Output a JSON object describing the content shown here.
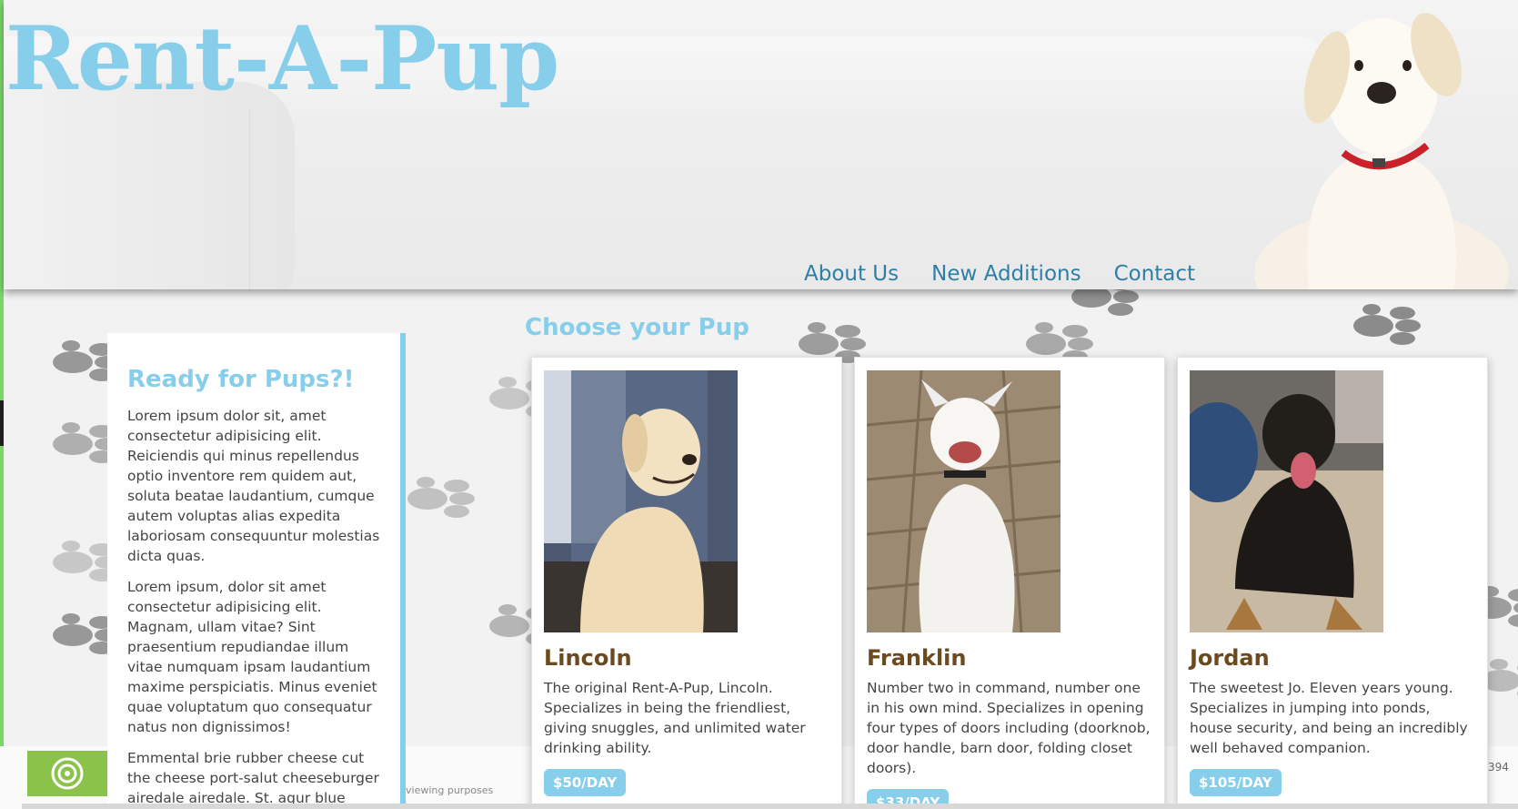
{
  "site": {
    "logo": "Rent-A-Pup",
    "nav": [
      "About Us",
      "New Additions",
      "Contact"
    ]
  },
  "sidebar": {
    "title": "Ready for Pups?!",
    "paragraphs": [
      "Lorem ipsum dolor sit, amet consectetur adipisicing elit. Reiciendis qui minus repellendus optio inventore rem quidem aut, soluta beatae laudantium, cumque autem voluptas alias expedita laboriosam consequuntur molestias dicta quas.",
      "Lorem ipsum, dolor sit amet consectetur adipisicing elit. Magnam, ullam vitae? Sint praesentium repudiandae illum vitae numquam ipsam laudantium maxime perspiciatis. Minus eveniet quae voluptatum quo consequatur natus non dignissimos!",
      "Emmental brie rubber cheese cut the cheese port-salut cheeseburger airedale airedale. St. agur blue cheese babybel manchego caerphilly."
    ]
  },
  "main": {
    "section_title": "Choose your Pup",
    "cards": [
      {
        "name": "Lincoln",
        "description": "The original Rent-A-Pup, Lincoln. Specializes in being the friendliest, giving snuggles, and unlimited water drinking ability.",
        "price": "$50/DAY"
      },
      {
        "name": "Franklin",
        "description": "Number two in command, number one in his own mind. Specializes in opening four types of doors including (doorknob, door handle, barn door, folding closet doors).",
        "price": "$33/DAY"
      },
      {
        "name": "Jordan",
        "description": "The sweetest Jo. Eleven years young. Specializes in jumping into ponds, house security, and being an incredibly well behaved companion.",
        "price": "$105/DAY"
      }
    ]
  },
  "footer": {
    "text": "viewing purposes",
    "number": "394"
  },
  "colors": {
    "accent": "#87ceeb",
    "nav_link": "#2e7fa6",
    "card_title": "#6b4a1f",
    "paw": "#8a8a8a"
  }
}
